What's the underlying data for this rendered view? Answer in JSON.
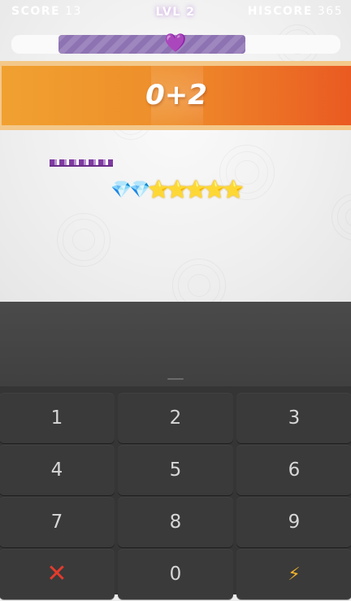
{
  "hud": {
    "score_label": "SCORE",
    "score_value": "13",
    "level_label": "LVL 2",
    "hiscore_label": "HISCORE",
    "hiscore_value": "365"
  },
  "progress": {
    "fraction": 0.71,
    "icon": "heart-icon"
  },
  "equation": "0+2",
  "rewards": {
    "gems": 2,
    "stars": 5,
    "gem_glyph": "💎",
    "star_glyph": "⭐"
  },
  "keypad": {
    "keys": [
      "1",
      "2",
      "3",
      "4",
      "5",
      "6",
      "7",
      "8",
      "9",
      "✕",
      "0",
      "⚡"
    ]
  },
  "colors": {
    "banner_start": "#f0a130",
    "banner_end": "#ea5a22",
    "progress_fill": "#9e86be",
    "clear": "#e43b2c",
    "bolt": "#f1b32c"
  }
}
